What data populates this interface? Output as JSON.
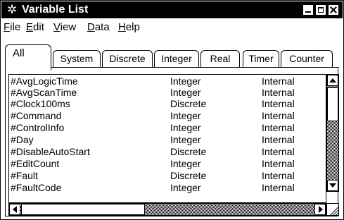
{
  "window": {
    "title": "Variable List",
    "icon": "gear-icon"
  },
  "menu": [
    {
      "label": "File",
      "key": "F",
      "rest": "ile"
    },
    {
      "label": "Edit",
      "key": "E",
      "rest": "dit"
    },
    {
      "label": "View",
      "key": "V",
      "rest": "iew"
    },
    {
      "label": "Data",
      "key": "D",
      "rest": "ata"
    },
    {
      "label": "Help",
      "key": "H",
      "rest": "elp"
    }
  ],
  "tabs": [
    "All",
    "System",
    "Discrete",
    "Integer",
    "Real",
    "Timer",
    "Counter"
  ],
  "active_tab": "All",
  "rows": [
    {
      "name": "#AvgLogicTime",
      "type": "Integer",
      "scope": "Internal"
    },
    {
      "name": "#AvgScanTime",
      "type": "Integer",
      "scope": "Internal"
    },
    {
      "name": "#Clock100ms",
      "type": "Discrete",
      "scope": "Internal"
    },
    {
      "name": "#Command",
      "type": "Integer",
      "scope": "Internal"
    },
    {
      "name": "#ControlInfo",
      "type": "Integer",
      "scope": "Internal"
    },
    {
      "name": "#Day",
      "type": "Integer",
      "scope": "Internal"
    },
    {
      "name": "#DisableAutoStart",
      "type": "Discrete",
      "scope": "Internal"
    },
    {
      "name": "#EditCount",
      "type": "Integer",
      "scope": "Internal"
    },
    {
      "name": "#Fault",
      "type": "Discrete",
      "scope": "Internal"
    },
    {
      "name": "#FaultCode",
      "type": "Integer",
      "scope": "Internal"
    }
  ]
}
